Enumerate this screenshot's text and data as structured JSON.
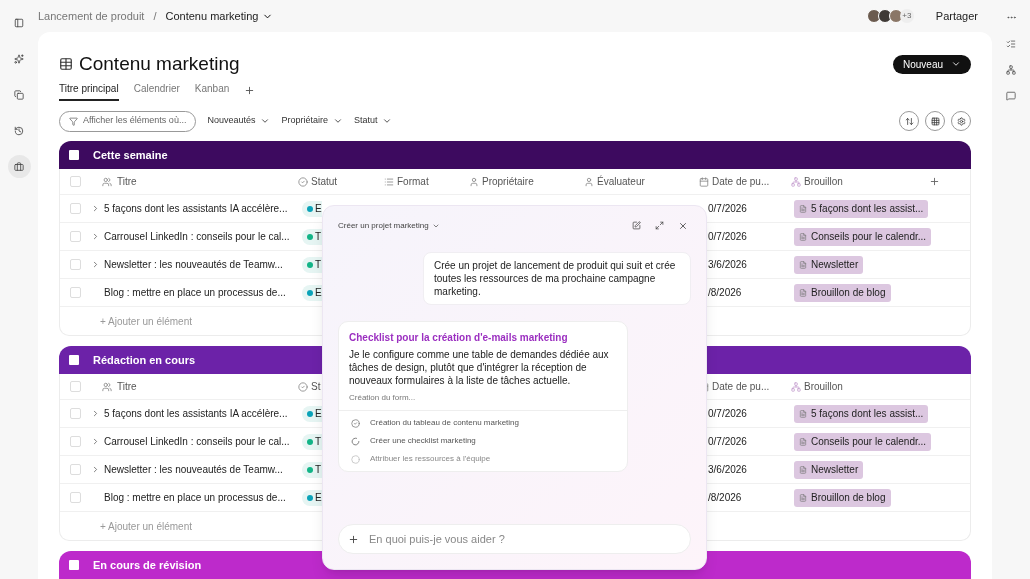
{
  "breadcrumb": {
    "parent": "Lancement de produit",
    "separator": "/",
    "current": "Contenu marketing"
  },
  "header": {
    "avatars_extra": "+3",
    "share": "Partager"
  },
  "rail": {
    "items": [
      {
        "selected": false
      },
      {
        "selected": false
      },
      {
        "selected": false
      },
      {
        "selected": false
      },
      {
        "selected": true
      }
    ]
  },
  "page": {
    "title": "Contenu marketing",
    "new_button": "Nouveau"
  },
  "tabs": [
    {
      "label": "Titre principal",
      "selected": true
    },
    {
      "label": "Calendrier",
      "selected": false
    },
    {
      "label": "Kanban",
      "selected": false
    }
  ],
  "filters": {
    "search": "Afficher les éléments où...",
    "dropdowns": [
      "Nouveautés",
      "Propriétaire",
      "Statut"
    ]
  },
  "groups": [
    {
      "name": "Cette semaine",
      "color": "#3d0a5f",
      "add_column": true,
      "header_checked": false,
      "columns": [
        {
          "kind": "title",
          "label": "Titre"
        },
        {
          "kind": "status",
          "label": "Statut"
        },
        {
          "kind": "format",
          "label": "Format"
        },
        {
          "kind": "owner",
          "label": "Propriétaire"
        },
        {
          "kind": "reviewer",
          "label": "Évaluateur"
        },
        {
          "kind": "date",
          "label": "Date de pu..."
        },
        {
          "kind": "draft",
          "label": "Brouillon"
        }
      ],
      "rows": [
        {
          "checked": false,
          "expandable": true,
          "title": "5 façons dont les assistants IA accélère...",
          "status": "E",
          "color": "#0aa3b8",
          "date": "0/7/2026",
          "draft": "5 façons dont les assist..."
        },
        {
          "checked": false,
          "expandable": true,
          "title": "Carrousel LinkedIn : conseils pour le cal...",
          "status": "T",
          "color": "#13b487",
          "date": "0/7/2026",
          "draft": "Conseils pour le calendr..."
        },
        {
          "checked": false,
          "expandable": true,
          "title": "Newsletter : les nouveautés de Teamw...",
          "status": "T",
          "color": "#13b487",
          "date": "3/6/2026",
          "draft": "Newsletter"
        },
        {
          "checked": false,
          "expandable": false,
          "title": "Blog : mettre en place un processus de...",
          "status": "E",
          "color": "#0aa3b8",
          "date": "/8/2026",
          "draft": "Brouillon de blog"
        }
      ],
      "add_item": "+ Ajouter un élément"
    },
    {
      "name": "Rédaction en cours",
      "color": "#6c22a8",
      "header_checked": false,
      "columns": [
        {
          "kind": "title",
          "label": "Titre"
        },
        {
          "kind": "status",
          "label": "St"
        },
        {
          "kind": "date",
          "label": "Date de pu..."
        },
        {
          "kind": "draft",
          "label": "Brouillon"
        }
      ],
      "rows": [
        {
          "checked": false,
          "expandable": true,
          "title": "5 façons dont les assistants IA accélère...",
          "status": "E",
          "color": "#0aa3b8",
          "date": "0/7/2026",
          "draft": "5 façons dont les assist..."
        },
        {
          "checked": false,
          "expandable": true,
          "title": "Carrousel LinkedIn : conseils pour le cal...",
          "status": "T",
          "color": "#13b487",
          "date": "0/7/2026",
          "draft": "Conseils pour le calendr..."
        },
        {
          "checked": false,
          "expandable": true,
          "title": "Newsletter : les nouveautés de Teamw...",
          "status": "T",
          "color": "#13b487",
          "date": "3/6/2026",
          "draft": "Newsletter"
        },
        {
          "checked": false,
          "expandable": false,
          "title": "Blog : mettre en place un processus de...",
          "status": "E",
          "color": "#0aa3b8",
          "date": "/8/2026",
          "draft": "Brouillon de blog"
        }
      ],
      "add_item": "+ Ajouter un élément"
    },
    {
      "name": "En cours de révision",
      "color": "#bd2acb"
    }
  ],
  "assistant": {
    "title": "Créer un projet marketing",
    "user_message": "Crée un projet de lancement de produit qui suit et crée toutes les ressources de ma prochaine campagne marketing.",
    "card": {
      "title": "Checklist pour la création d'e-mails marketing",
      "body": "Je le configure comme une table de demandes dédiée aux tâches de design, plutôt que d'intégrer la réception de nouveaux formulaires à la liste de tâches actuelle.",
      "progress": "Création du form...",
      "steps": [
        {
          "label": "Création du tableau de contenu marketing",
          "kind": "done"
        },
        {
          "label": "Créer une checklist marketing",
          "kind": "running"
        },
        {
          "label": "Attribuer les ressources à l'équipe",
          "kind": "pending"
        }
      ]
    },
    "input": {
      "placeholder": "En quoi puis-je vous aider ?"
    }
  }
}
